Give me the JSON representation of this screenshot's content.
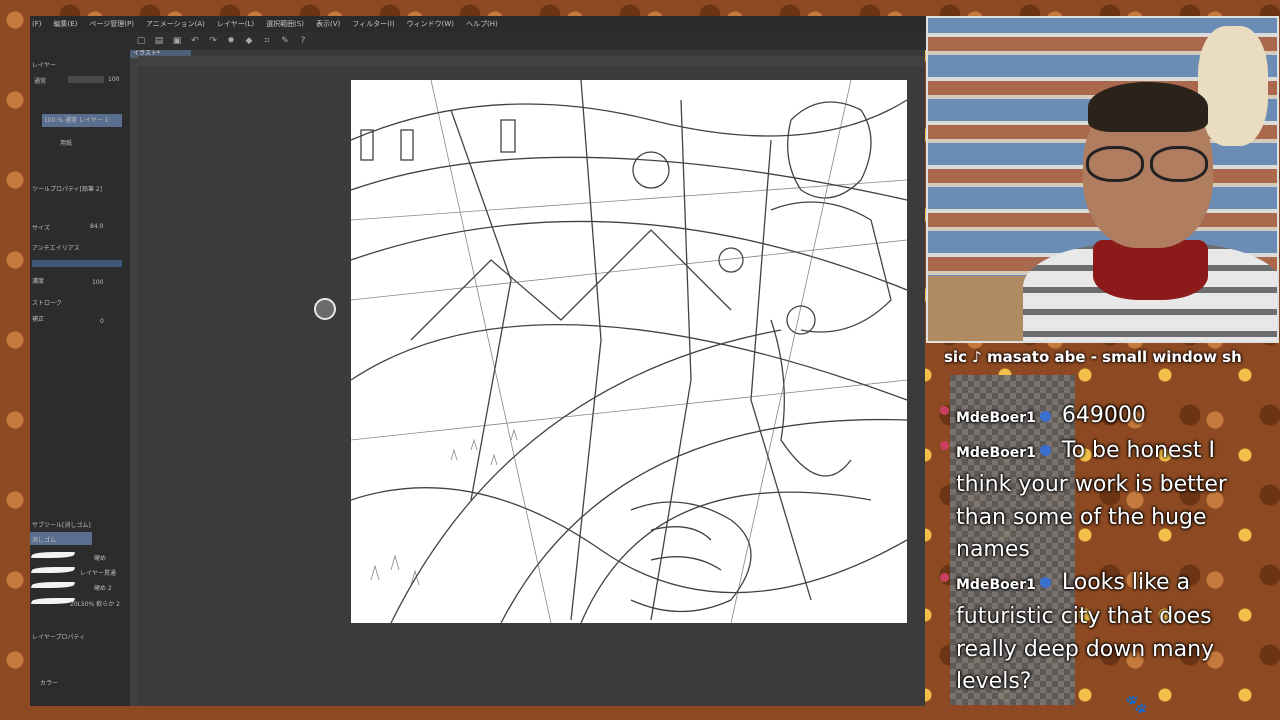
{
  "menu": [
    "(F)",
    "編集(E)",
    "ページ管理(P)",
    "アニメーション(A)",
    "レイヤー(L)",
    "選択範囲(S)",
    "表示(V)",
    "フィルター(I)",
    "ウィンドウ(W)",
    "ヘルプ(H)"
  ],
  "document_tab": "イラスト*",
  "left_panel": {
    "layer_label": "レイヤー",
    "blend_mode": "通常",
    "opacity_value": "100",
    "layer_name": "100 % 通常 レイヤー 1",
    "paper_layer": "用紙",
    "tool_property": "ツールプロパティ[鉛筆 2]",
    "size_label": "サイズ",
    "size_value": "84.0",
    "antialias_label": "アンチエイリアス",
    "density_label": "濃度",
    "density_value": "100",
    "stroke_label": "ストローク",
    "correction_label": "補正",
    "correction_value": "0",
    "subtool_label": "サブツール[消しゴム]",
    "eraser_label": "消しゴム",
    "brushes": [
      "硬め",
      "レイヤー貫通",
      "硬め 2",
      "20L50% 軟らか 2"
    ],
    "layer_property": "レイヤープロパティ",
    "color_label": "カラー"
  },
  "music": "sic ♪ masato abe - small window sh",
  "chat": [
    {
      "user": "MdeBoer1",
      "text": "649000"
    },
    {
      "user": "MdeBoer1",
      "text": "To be honest I think your work is better than some of the huge names"
    },
    {
      "user": "MdeBoer1",
      "text": "Looks like a futuristic city that does really deep down many levels?"
    }
  ],
  "colors": {
    "menu_bg": "#2b2b2b",
    "panel_bg": "#2c2c2c",
    "workspace_bg": "#3b3b3b",
    "canvas_bg": "#ffffff",
    "badge": "#3a6fd0"
  },
  "icons": [
    "undo-icon",
    "redo-icon",
    "new-file-icon",
    "open-icon",
    "save-icon",
    "help-icon",
    "cat-paw-icon"
  ]
}
